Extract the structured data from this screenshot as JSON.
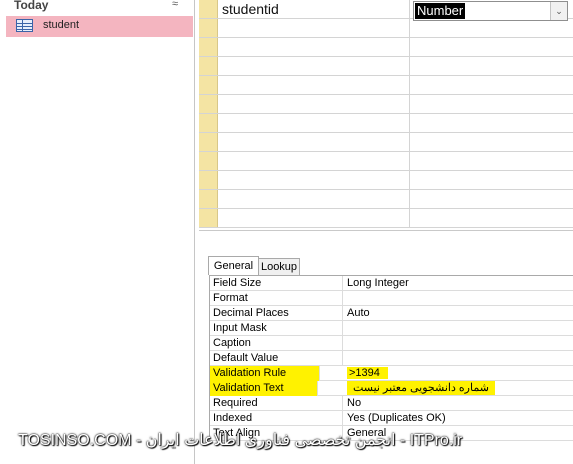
{
  "nav": {
    "group_title": "Today",
    "collapse_glyph": "≈",
    "items": [
      {
        "label": "student",
        "icon": "table-icon"
      }
    ]
  },
  "grid": {
    "rows": [
      {
        "field_name": "studentid",
        "data_type": "Number",
        "dropdown_glyph": "⌄"
      }
    ]
  },
  "properties": {
    "tabs": [
      {
        "label": "General",
        "active": true
      },
      {
        "label": "Lookup",
        "active": false
      }
    ],
    "rows": [
      {
        "name": "Field Size",
        "value": "Long Integer"
      },
      {
        "name": "Format",
        "value": ""
      },
      {
        "name": "Decimal Places",
        "value": "Auto"
      },
      {
        "name": "Input Mask",
        "value": ""
      },
      {
        "name": "Caption",
        "value": ""
      },
      {
        "name": "Default Value",
        "value": ""
      },
      {
        "name": "Validation Rule",
        "value": ">1394"
      },
      {
        "name": "Validation Text",
        "value": "شماره دانشجویی معتبر نیست"
      },
      {
        "name": "Required",
        "value": "No"
      },
      {
        "name": "Indexed",
        "value": "Yes (Duplicates OK)"
      },
      {
        "name": "Text Align",
        "value": "General"
      }
    ],
    "highlight_color": "#fff200"
  },
  "watermark": {
    "text": "TOSINSO.COM - انجمن تخصصی فناوری اطلاعات ایران - ITPro.ir"
  }
}
